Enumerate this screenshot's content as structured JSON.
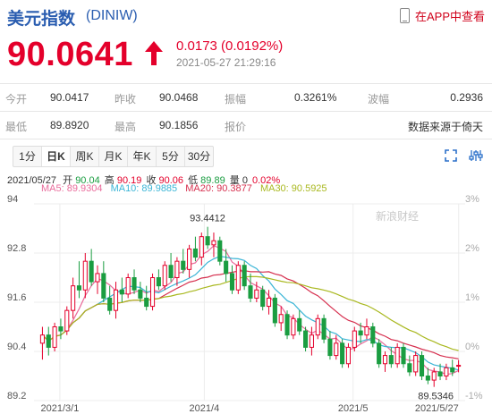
{
  "header": {
    "title": "美元指数",
    "code": "(DINIW)",
    "app_link": "在APP中查看"
  },
  "quote": {
    "price": "90.0641",
    "change": "0.0173 (0.0192%)",
    "timestamp": "2021-05-27 21:29:16",
    "direction": "up",
    "color": "#e4002b"
  },
  "stats": {
    "open_label": "今开",
    "open": "90.0417",
    "prev_close_label": "昨收",
    "prev_close": "90.0468",
    "amplitude_label": "振幅",
    "amplitude": "0.3261%",
    "range_label": "波幅",
    "range": "0.2936",
    "low_label": "最低",
    "low": "89.8920",
    "high_label": "最高",
    "high": "90.1856",
    "report_label": "报价",
    "source": "数据来源于倚天"
  },
  "tabs": [
    "1分",
    "日K",
    "周K",
    "月K",
    "年K",
    "5分",
    "30分"
  ],
  "active_tab": "日K",
  "ohlc_bar": {
    "date": "2021/05/27",
    "open_label": "开",
    "open": "90.04",
    "high_label": "高",
    "high": "90.19",
    "close_label": "收",
    "close": "90.06",
    "low_label": "低",
    "low": "89.89",
    "vol_label": "量",
    "vol": "0",
    "pct": "0.02%"
  },
  "ma": {
    "ma5": "MA5: 89.9304",
    "ma10": "MA10: 89.9885",
    "ma20": "MA20: 90.3877",
    "ma30": "MA30: 90.5925"
  },
  "watermark": "新浪财经",
  "colors": {
    "up": "#e4002b",
    "down": "#1a9d41",
    "ma5": "#e96b9b",
    "ma10": "#3bb5d6",
    "ma20": "#d6304f",
    "ma30": "#a9b81f",
    "grid": "#ececec"
  },
  "chart_data": {
    "type": "candlestick",
    "y_ticks": [
      "94",
      "92.8",
      "91.6",
      "90.4",
      "89.2"
    ],
    "pct_ticks": [
      "3%",
      "2%",
      "1%",
      "0%",
      "-1%"
    ],
    "x_ticks": [
      "2021/3/1",
      "2021/4",
      "2021/5",
      "2021/5/27"
    ],
    "ylim": [
      89.2,
      94
    ],
    "annotations": {
      "high": "93.4412",
      "low": "89.5346"
    },
    "candles": [
      [
        90.6,
        91.0,
        90.2,
        90.8
      ],
      [
        90.8,
        91.0,
        90.3,
        90.5
      ],
      [
        90.5,
        91.1,
        90.4,
        91.0
      ],
      [
        91.0,
        91.2,
        90.7,
        90.9
      ],
      [
        90.9,
        91.5,
        90.8,
        91.4
      ],
      [
        91.4,
        92.2,
        91.2,
        92.0
      ],
      [
        92.0,
        92.6,
        91.7,
        91.9
      ],
      [
        91.9,
        92.8,
        91.7,
        92.6
      ],
      [
        92.6,
        92.9,
        92.0,
        92.1
      ],
      [
        92.1,
        92.5,
        91.8,
        92.3
      ],
      [
        92.3,
        92.6,
        91.6,
        91.7
      ],
      [
        91.7,
        92.0,
        91.3,
        91.4
      ],
      [
        91.4,
        92.1,
        91.2,
        91.9
      ],
      [
        91.9,
        92.2,
        91.6,
        91.8
      ],
      [
        91.8,
        92.3,
        91.7,
        92.2
      ],
      [
        92.2,
        92.4,
        91.8,
        91.9
      ],
      [
        91.9,
        92.1,
        91.6,
        91.7
      ],
      [
        91.7,
        92.0,
        91.4,
        91.5
      ],
      [
        91.5,
        92.3,
        91.4,
        92.2
      ],
      [
        92.2,
        92.4,
        91.9,
        92.0
      ],
      [
        92.0,
        92.6,
        91.9,
        92.5
      ],
      [
        92.5,
        92.8,
        92.1,
        92.2
      ],
      [
        92.2,
        92.7,
        92.0,
        92.6
      ],
      [
        92.6,
        92.9,
        92.3,
        92.4
      ],
      [
        92.4,
        93.0,
        92.2,
        92.9
      ],
      [
        92.9,
        93.2,
        92.6,
        92.7
      ],
      [
        92.7,
        93.3,
        92.5,
        93.2
      ],
      [
        93.2,
        93.44,
        92.9,
        93.0
      ],
      [
        93.0,
        93.3,
        92.7,
        93.1
      ],
      [
        93.1,
        93.2,
        92.5,
        92.6
      ],
      [
        92.6,
        92.9,
        92.1,
        92.3
      ],
      [
        92.3,
        92.5,
        91.8,
        91.9
      ],
      [
        91.9,
        92.6,
        91.8,
        92.5
      ],
      [
        92.5,
        92.6,
        91.9,
        92.0
      ],
      [
        92.0,
        92.3,
        91.6,
        91.7
      ],
      [
        91.7,
        92.1,
        91.6,
        91.9
      ],
      [
        91.9,
        92.0,
        91.4,
        91.5
      ],
      [
        91.5,
        91.9,
        91.3,
        91.7
      ],
      [
        91.7,
        91.8,
        91.0,
        91.1
      ],
      [
        91.1,
        91.5,
        90.9,
        91.3
      ],
      [
        91.3,
        91.4,
        90.7,
        90.8
      ],
      [
        90.8,
        91.3,
        90.7,
        91.2
      ],
      [
        91.2,
        91.4,
        90.8,
        90.9
      ],
      [
        90.9,
        91.0,
        90.4,
        90.5
      ],
      [
        90.5,
        91.0,
        90.3,
        90.8
      ],
      [
        90.8,
        91.3,
        90.7,
        91.2
      ],
      [
        91.2,
        91.3,
        90.6,
        90.7
      ],
      [
        90.7,
        90.9,
        90.2,
        90.3
      ],
      [
        90.3,
        90.8,
        90.2,
        90.6
      ],
      [
        90.6,
        90.7,
        90.0,
        90.1
      ],
      [
        90.1,
        90.6,
        90.0,
        90.5
      ],
      [
        90.5,
        91.0,
        90.4,
        90.9
      ],
      [
        90.9,
        91.1,
        90.6,
        90.8
      ],
      [
        90.8,
        91.2,
        90.7,
        91.0
      ],
      [
        91.0,
        91.1,
        90.5,
        90.6
      ],
      [
        90.6,
        90.7,
        90.0,
        90.1
      ],
      [
        90.1,
        90.4,
        89.9,
        90.3
      ],
      [
        90.3,
        90.5,
        90.0,
        90.1
      ],
      [
        90.1,
        90.6,
        90.0,
        90.5
      ],
      [
        90.5,
        90.6,
        90.0,
        90.1
      ],
      [
        90.1,
        90.3,
        89.8,
        89.9
      ],
      [
        89.9,
        90.4,
        89.8,
        90.3
      ],
      [
        90.3,
        90.4,
        89.7,
        89.8
      ],
      [
        89.8,
        90.0,
        89.6,
        89.7
      ],
      [
        89.7,
        90.0,
        89.5346,
        89.9
      ],
      [
        89.9,
        90.1,
        89.7,
        89.8
      ],
      [
        89.8,
        90.1,
        89.7,
        90.0
      ],
      [
        90.0,
        90.2,
        89.8,
        89.9
      ],
      [
        90.04,
        90.19,
        89.89,
        90.06
      ]
    ]
  }
}
